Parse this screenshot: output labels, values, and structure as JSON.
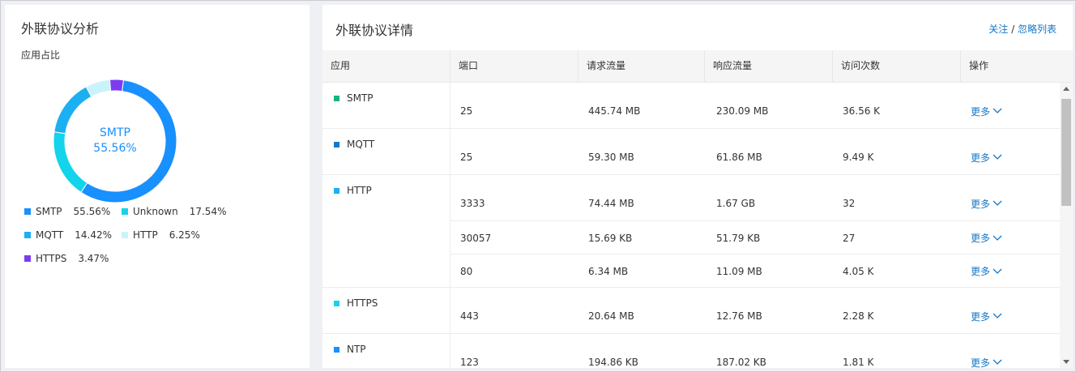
{
  "left_panel": {
    "title": "外联协议分析",
    "subtitle": "应用占比",
    "donut_center": {
      "label": "SMTP",
      "value": "55.56%"
    }
  },
  "chart_data": {
    "type": "pie",
    "variant": "donut",
    "slices": [
      {
        "name": "SMTP",
        "percent": "55.56%",
        "value": 55.56,
        "color": "#1890ff"
      },
      {
        "name": "Unknown",
        "percent": "17.54%",
        "value": 17.54,
        "color": "#13d4ea"
      },
      {
        "name": "MQTT",
        "percent": "14.42%",
        "value": 14.42,
        "color": "#1bb0f2"
      },
      {
        "name": "HTTP",
        "percent": "6.25%",
        "value": 6.25,
        "color": "#c9f3fb"
      },
      {
        "name": "HTTPS",
        "percent": "3.47%",
        "value": 3.47,
        "color": "#7b3cf0"
      }
    ]
  },
  "right_panel": {
    "title": "外联协议详情",
    "link_follow": "关注",
    "link_separator": "/",
    "link_ignore": "忽略列表"
  },
  "table": {
    "headers": [
      "应用",
      "端口",
      "请求流量",
      "响应流量",
      "访问次数",
      "操作"
    ],
    "groups": [
      {
        "app": "SMTP",
        "color": "#19b37a",
        "rows": [
          {
            "port": "25",
            "request": "445.74 MB",
            "response": "230.09 MB",
            "visits": "36.56 K",
            "action": "更多"
          }
        ]
      },
      {
        "app": "MQTT",
        "color": "#1478c8",
        "rows": [
          {
            "port": "25",
            "request": "59.30 MB",
            "response": "61.86 MB",
            "visits": "9.49 K",
            "action": "更多"
          }
        ]
      },
      {
        "app": "HTTP",
        "color": "#1bb0f2",
        "rows": [
          {
            "port": "3333",
            "request": "74.44 MB",
            "response": "1.67 GB",
            "visits": "32",
            "action": "更多"
          },
          {
            "port": "30057",
            "request": "15.69 KB",
            "response": "51.79 KB",
            "visits": "27",
            "action": "更多"
          },
          {
            "port": "80",
            "request": "6.34 MB",
            "response": "11.09 MB",
            "visits": "4.05 K",
            "action": "更多"
          }
        ]
      },
      {
        "app": "HTTPS",
        "color": "#13d4ea",
        "rows": [
          {
            "port": "443",
            "request": "20.64 MB",
            "response": "12.76 MB",
            "visits": "2.28 K",
            "action": "更多"
          }
        ]
      },
      {
        "app": "NTP",
        "color": "#1890ff",
        "rows": [
          {
            "port": "123",
            "request": "194.86 KB",
            "response": "187.02 KB",
            "visits": "1.81 K",
            "action": "更多"
          }
        ]
      }
    ]
  }
}
